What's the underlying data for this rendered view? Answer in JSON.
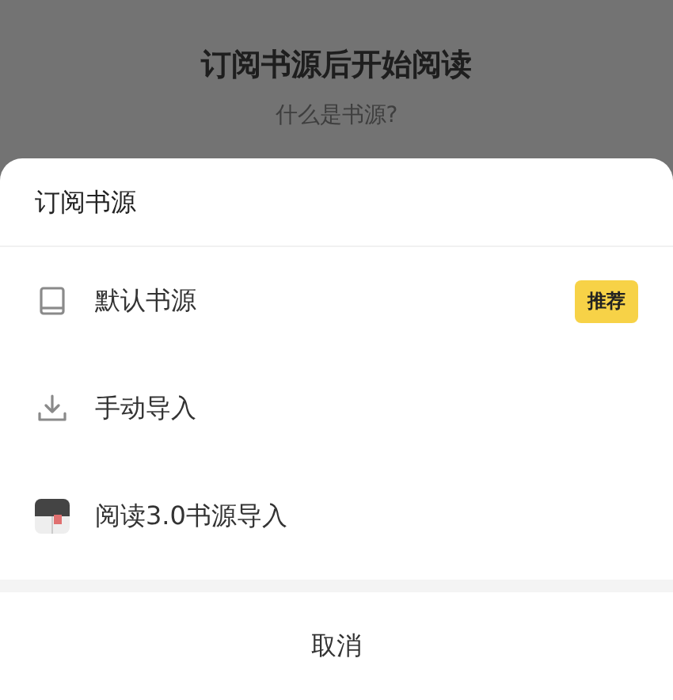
{
  "background": {
    "title": "订阅书源后开始阅读",
    "link": "什么是书源?"
  },
  "sheet": {
    "title": "订阅书源",
    "options": [
      {
        "kind": "book",
        "label": "默认书源",
        "badge": "推荐"
      },
      {
        "kind": "download",
        "label": "手动导入"
      },
      {
        "kind": "app",
        "label": "阅读3.0书源导入"
      }
    ],
    "cancel": "取消"
  }
}
